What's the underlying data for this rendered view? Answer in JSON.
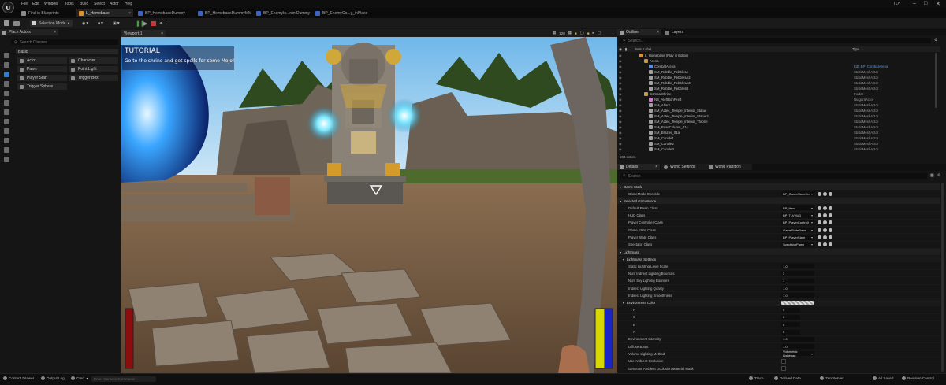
{
  "app": {
    "logo": "U",
    "menu": [
      "File",
      "Edit",
      "Window",
      "Tools",
      "Build",
      "Select",
      "Actor",
      "Help"
    ],
    "window_title": "TLV"
  },
  "tabs": [
    {
      "label": "Find in Blueprints",
      "icon": "search-icon",
      "active": false,
      "color": "#8a8a8a"
    },
    {
      "label": "L_Homebase",
      "icon": "level-icon",
      "active": true,
      "color": "#e08f2b"
    },
    {
      "label": "BP_HomebaseDummy",
      "icon": "blueprint-icon",
      "active": false,
      "color": "#3a63c9"
    },
    {
      "label": "BP_HomebaseDummyMM",
      "icon": "blueprint-icon",
      "active": false,
      "color": "#3a63c9"
    },
    {
      "label": "BP_EnemyIn...runtDummy",
      "icon": "blueprint-icon",
      "active": false,
      "color": "#3a63c9"
    },
    {
      "label": "BP_EnemyCo...y_inPlace",
      "icon": "blueprint-icon",
      "active": false,
      "color": "#3a63c9"
    }
  ],
  "toolbar": {
    "selection_mode": "Selection Mode",
    "play_colors": {
      "play": "#3aa63a",
      "stop": "#c83a3a"
    }
  },
  "place_actors": {
    "tab_label": "Place Actors",
    "search_placeholder": "Search Classes",
    "section": "Basic",
    "actors": [
      "Actor",
      "Character",
      "Pawn",
      "Point Light",
      "Player Start",
      "Trigger Box",
      "Trigger Sphere"
    ]
  },
  "viewport": {
    "tab_label": "Viewport 1",
    "fov": "120",
    "hud_title": "TUTORIAL",
    "hud_text": "Go to the shrine and get spells for some Mojo!",
    "health_color": "#8b0d0d",
    "mana_colors": [
      "#d8d800",
      "#1a24c8"
    ]
  },
  "outliner": {
    "tab_label": "Outliner",
    "tab2_label": "Layers",
    "search_placeholder": "Search...",
    "col_label": "Item Label",
    "col_type": "Type",
    "rows": [
      {
        "label": "L_Homebase (Play in Editor)",
        "type": "",
        "indent": 0,
        "icon": "level"
      },
      {
        "label": "Arena",
        "type": "",
        "indent": 1,
        "icon": "folder"
      },
      {
        "label": "CombatArena",
        "type": "Edit BP_CombatArena",
        "indent": 2,
        "icon": "bp",
        "link": true
      },
      {
        "label": "SM_Rubble_PebblesA",
        "type": "StaticMeshActor",
        "indent": 2,
        "icon": "mesh"
      },
      {
        "label": "SM_Rubble_PebblesA2",
        "type": "StaticMeshActor",
        "indent": 2,
        "icon": "mesh"
      },
      {
        "label": "SM_Rubble_PebblesA3",
        "type": "StaticMeshActor",
        "indent": 2,
        "icon": "mesh"
      },
      {
        "label": "SM_Rubble_PebblesB",
        "type": "StaticMeshActor",
        "indent": 2,
        "icon": "mesh"
      },
      {
        "label": "CombatShrine",
        "type": "Folder",
        "indent": 1,
        "icon": "folder"
      },
      {
        "label": "NS_AloftBonFire3",
        "type": "NiagaraActor",
        "indent": 2,
        "icon": "fx"
      },
      {
        "label": "SM_Altar2",
        "type": "StaticMeshActor",
        "indent": 2,
        "icon": "mesh"
      },
      {
        "label": "SM_Aztec_Temple_Interior_Statue",
        "type": "StaticMeshActor",
        "indent": 2,
        "icon": "mesh"
      },
      {
        "label": "SM_Aztec_Temple_Interior_Statue2",
        "type": "StaticMeshActor",
        "indent": 2,
        "icon": "mesh"
      },
      {
        "label": "SM_Aztec_Temple_Interior_Throne",
        "type": "StaticMeshActor",
        "indent": 2,
        "icon": "mesh"
      },
      {
        "label": "SM_BaseColumn_01c",
        "type": "StaticMeshActor",
        "indent": 2,
        "icon": "mesh"
      },
      {
        "label": "SM_Brazier_01a",
        "type": "StaticMeshActor",
        "indent": 2,
        "icon": "mesh"
      },
      {
        "label": "SM_Candle1",
        "type": "StaticMeshActor",
        "indent": 2,
        "icon": "mesh"
      },
      {
        "label": "SM_Candle2",
        "type": "StaticMeshActor",
        "indent": 2,
        "icon": "mesh"
      },
      {
        "label": "SM_Candle3",
        "type": "StaticMeshActor",
        "indent": 2,
        "icon": "mesh"
      }
    ],
    "footer": "503 actors"
  },
  "details": {
    "tabs": [
      "Details",
      "World Settings",
      "World Partition"
    ],
    "search_placeholder": "Search",
    "sections": [
      {
        "title": "Game Mode",
        "rows": [
          {
            "label": "GameMode Override",
            "value": "BP_GameModeHo",
            "kind": "dd"
          }
        ]
      },
      {
        "title": "Selected GameMode",
        "rows": [
          {
            "label": "Default Pawn Class",
            "value": "BP_Hero",
            "kind": "dd"
          },
          {
            "label": "HUD Class",
            "value": "BP_TLVHUD",
            "kind": "dd"
          },
          {
            "label": "Player Controller Class",
            "value": "BP_PlayerControll",
            "kind": "dd"
          },
          {
            "label": "Game State Class",
            "value": "GameStateBase",
            "kind": "dd"
          },
          {
            "label": "Player State Class",
            "value": "BP_PlayerState",
            "kind": "dd"
          },
          {
            "label": "Spectator Class",
            "value": "SpectatorPawn",
            "kind": "dd"
          }
        ]
      },
      {
        "title": "Lightmass",
        "rows": []
      },
      {
        "title": "Lightmass Settings",
        "sub": true,
        "rows": [
          {
            "label": "Static Lighting Level Scale",
            "value": "1.0",
            "kind": "num"
          },
          {
            "label": "Num Indirect Lighting Bounces",
            "value": "3",
            "kind": "num"
          },
          {
            "label": "Num Sky Lighting Bounces",
            "value": "1",
            "kind": "num"
          },
          {
            "label": "Indirect Lighting Quality",
            "value": "1.0",
            "kind": "num"
          },
          {
            "label": "Indirect Lighting Smoothness",
            "value": "1.0",
            "kind": "num"
          }
        ]
      },
      {
        "title": "Environment Color",
        "sub": true,
        "rows": [
          {
            "label": "R",
            "value": "0",
            "kind": "num"
          },
          {
            "label": "G",
            "value": "0",
            "kind": "num"
          },
          {
            "label": "B",
            "value": "0",
            "kind": "num"
          },
          {
            "label": "A",
            "value": "0",
            "kind": "num"
          }
        ]
      },
      {
        "title": "",
        "rows": [
          {
            "label": "Environment Intensity",
            "value": "1.0",
            "kind": "num"
          },
          {
            "label": "Diffuse Boost",
            "value": "1.0",
            "kind": "num"
          },
          {
            "label": "Volume Lighting Method",
            "value": "Volumetric Lightmap",
            "kind": "dd"
          },
          {
            "label": "Use Ambient Occlusion",
            "value": "",
            "kind": "check"
          },
          {
            "label": "Generate Ambient Occlusion Material Mask",
            "value": "",
            "kind": "check"
          }
        ]
      }
    ]
  },
  "statusbar": {
    "content_drawer": "Content Drawer",
    "output_log": "Output Log",
    "cmd": "Cmd",
    "cmd_placeholder": "Enter Console Command",
    "trace": "Trace",
    "derived_data": "Derived Data",
    "zen": "Zen Server",
    "saved": "All Saved",
    "revision": "Revision Control"
  }
}
